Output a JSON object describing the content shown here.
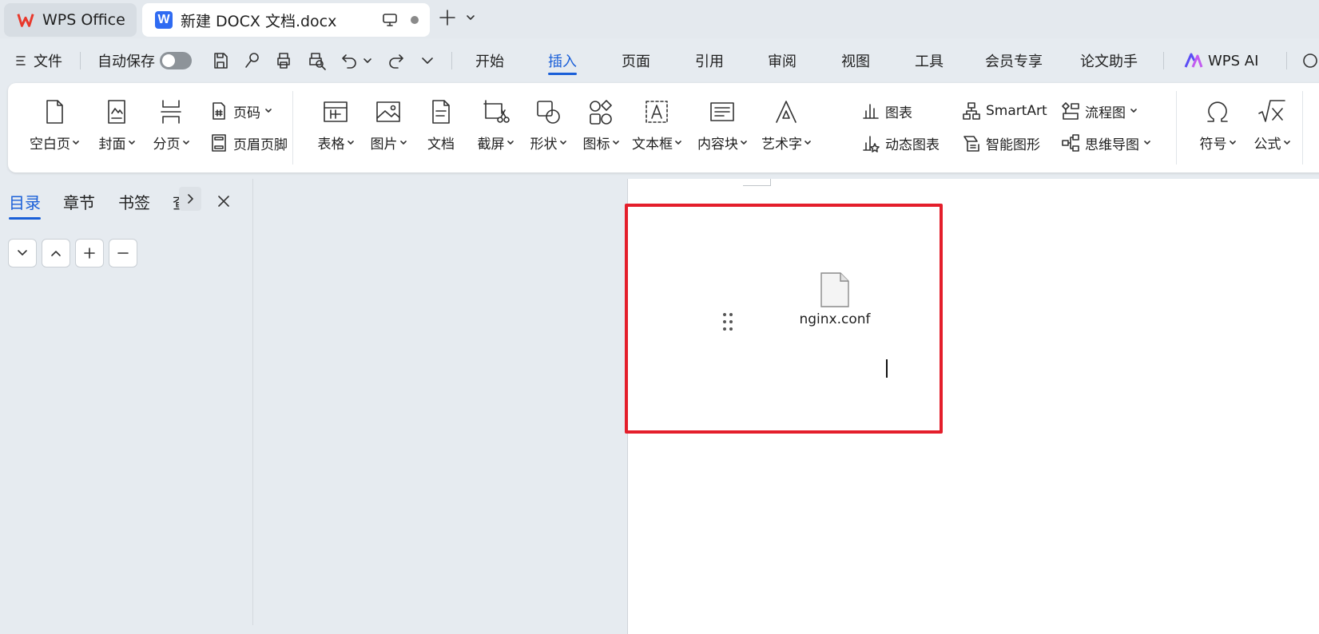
{
  "tabs": {
    "home": "WPS Office",
    "document": "新建 DOCX 文档.docx",
    "doc_logo_letter": "W"
  },
  "menu": {
    "file": "文件",
    "autosave": "自动保存",
    "tabs": [
      "开始",
      "插入",
      "页面",
      "引用",
      "审阅",
      "视图",
      "工具",
      "会员专享",
      "论文助手"
    ],
    "active_tab": "插入",
    "ai": "WPS AI"
  },
  "ribbon": {
    "blank_page": "空白页",
    "cover": "封面",
    "page_break": "分页",
    "page_number": "页码",
    "header_footer": "页眉页脚",
    "table": "表格",
    "picture": "图片",
    "document": "文档",
    "screenshot": "截屏",
    "shape": "形状",
    "icon": "图标",
    "textbox": "文本框",
    "content_block": "内容块",
    "wordart": "艺术字",
    "chart": "图表",
    "dynamic_chart": "动态图表",
    "smartart": "SmartArt",
    "smart_graphic": "智能图形",
    "flowchart": "流程图",
    "mindmap": "思维导图",
    "symbol": "符号",
    "formula": "公式"
  },
  "nav": {
    "tabs": [
      "目录",
      "章节",
      "书签",
      "查"
    ],
    "active": "目录"
  },
  "document": {
    "attachment_name": "nginx.conf"
  },
  "colors": {
    "accent": "#1a5fd8",
    "highlight_box": "#e41e2b",
    "wps_logo": "#e8382b",
    "doc_logo": "#2f6bf2"
  }
}
